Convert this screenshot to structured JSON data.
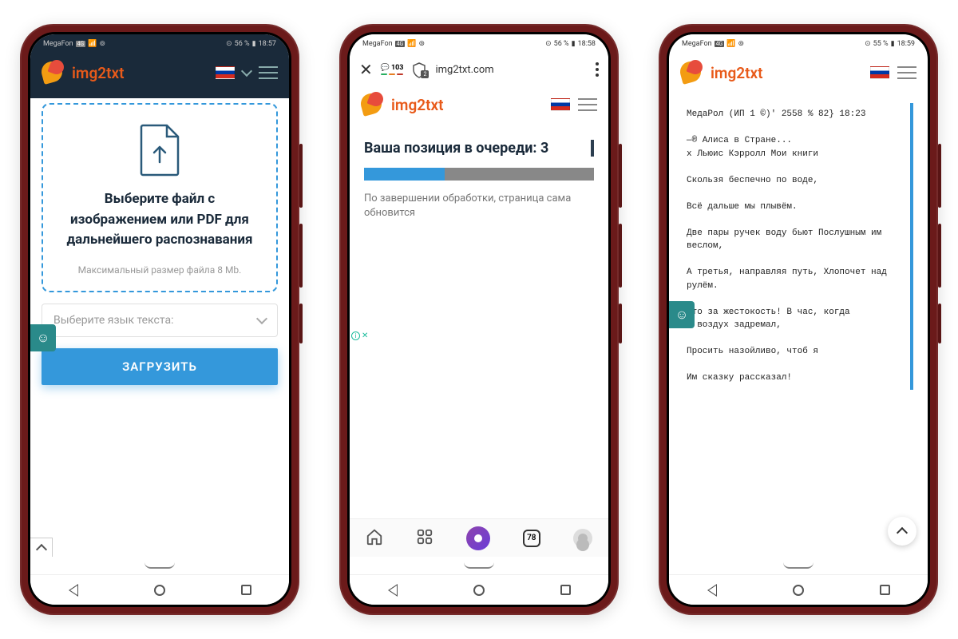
{
  "phones": {
    "p1": {
      "status": {
        "carrier": "MegaFon",
        "net": "4G",
        "battery": "56 %",
        "time": "18:57",
        "eye": "⊙"
      },
      "brand": "img2txt",
      "upload": {
        "title": "Выберите файл с изображением или PDF для дальнейшего распознавания",
        "subtitle": "Максимальный размер файла 8 Mb."
      },
      "lang_placeholder": "Выберите язык текста:",
      "button": "ЗАГРУЗИТЬ"
    },
    "p2": {
      "status": {
        "carrier": "MegaFon",
        "net": "4G",
        "battery": "56 %",
        "time": "18:58",
        "eye": "⊙"
      },
      "browser": {
        "comments": "103",
        "tabs_badge": "2",
        "url": "img2txt.com",
        "bottom_tabs": "78"
      },
      "brand": "img2txt",
      "queue_title": "Ваша позиция в очереди: 3",
      "queue_sub": "По завершении обработки, страница сама обновится"
    },
    "p3": {
      "status": {
        "carrier": "MegaFon",
        "net": "4G",
        "battery": "55 %",
        "time": "18:59",
        "eye": "⊙"
      },
      "brand": "img2txt",
      "result_text": "МедаРол (ИП 1 ©)' 2558 % 82} 18:23\n\n—® Алиса в Стране...\nх Льюис Кэрролл Мои книги\n\nСкользя беспечно по воде,\n\nВсё дальше мы плывём.\n\nДве пары ручек воду бьют Послушным им веслом,\n\nА третья, направляя путь, Хлопочет над рулём.\n\nЧто за жестокость! В час, когда\nИ воздух задремал,\n\nПросить назойливо, чтоб я\n\nИм сказку рассказал!"
    }
  }
}
